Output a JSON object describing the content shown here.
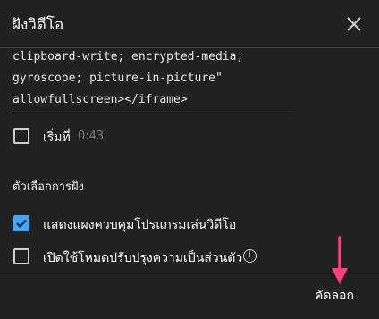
{
  "dialog": {
    "title": "ฝังวิดีโอ",
    "close_icon": "close-icon"
  },
  "embed_code": {
    "lines": [
      "clipboard-write; encrypted-media;",
      "gyroscope; picture-in-picture\"",
      "allowfullscreen></iframe>"
    ]
  },
  "start_option": {
    "label": "เริ่มที่",
    "time": "0:43",
    "checked": false
  },
  "options_section": {
    "title": "ตัวเลือกการฝัง",
    "items": [
      {
        "label": "แสดงแผงควบคุมโปรแกรมเล่นวิดีโอ",
        "checked": true
      },
      {
        "label": "เปิดใช้โหมดปรับปรุงความเป็นส่วนตัว",
        "checked": false,
        "info_icon": "info-icon"
      }
    ]
  },
  "footer": {
    "copy_label": "คัดลอก"
  },
  "colors": {
    "background": "#212121",
    "accent": "#3ea6ff",
    "annotation_arrow": "#ff3d7f"
  }
}
